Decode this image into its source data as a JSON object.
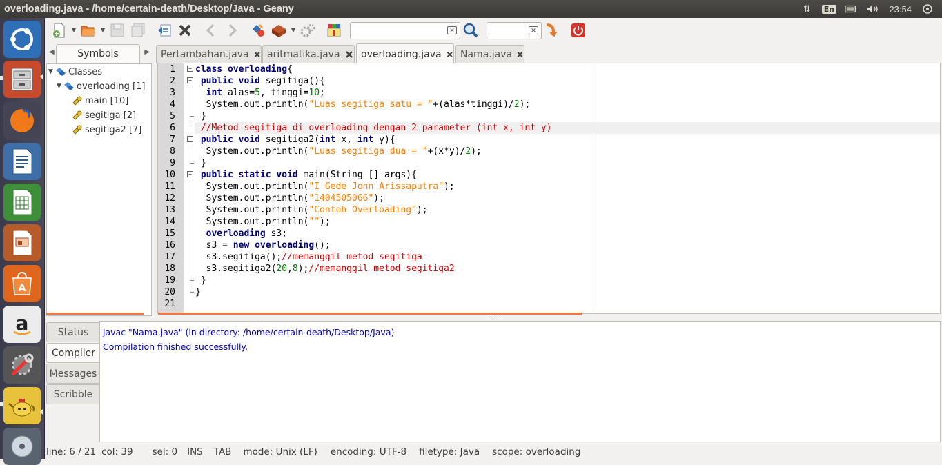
{
  "window": {
    "title": "overloading.java - /home/certain-death/Desktop/Java - Geany"
  },
  "tray": {
    "language": "En",
    "clock": "23:54"
  },
  "toolbar": {
    "search_value": "",
    "goto_value": ""
  },
  "sidebar": {
    "tab_label": "Symbols",
    "tree": [
      {
        "label": "Classes",
        "level": 0,
        "expanded": true
      },
      {
        "label": "overloading [1]",
        "level": 1,
        "expanded": true
      },
      {
        "label": "main [10]",
        "level": 2
      },
      {
        "label": "segitiga [2]",
        "level": 2
      },
      {
        "label": "segitiga2 [7]",
        "level": 2
      }
    ]
  },
  "tabs": [
    {
      "label": "Pertambahan.java",
      "active": false
    },
    {
      "label": "aritmatika.java",
      "active": false
    },
    {
      "label": "overloading.java",
      "active": true
    },
    {
      "label": "Nama.java",
      "active": false
    }
  ],
  "editor": {
    "current_line": 6,
    "lines": [
      {
        "n": "1",
        "fold": "open",
        "tokens": [
          [
            "kw",
            "class"
          ],
          [
            "",
            "​ "
          ],
          [
            "kw",
            "overloading"
          ],
          [
            "",
            "{"
          ]
        ]
      },
      {
        "n": "2",
        "fold": "open",
        "tokens": [
          [
            "",
            "​ "
          ],
          [
            "kw",
            "public"
          ],
          [
            "",
            "​ "
          ],
          [
            "kw",
            "void"
          ],
          [
            "",
            "​ segitiga(){"
          ]
        ]
      },
      {
        "n": "3",
        "fold": "line",
        "tokens": [
          [
            "",
            "​  "
          ],
          [
            "kw",
            "int"
          ],
          [
            "",
            "​ alas="
          ],
          [
            "num",
            "5"
          ],
          [
            "",
            ", tinggi="
          ],
          [
            "num",
            "10"
          ],
          [
            "",
            ";"
          ]
        ]
      },
      {
        "n": "4",
        "fold": "line",
        "tokens": [
          [
            "",
            "​  System.out.println("
          ],
          [
            "str",
            "\"Luas segitiga satu = \""
          ],
          [
            "",
            "+(alas*tinggi)/"
          ],
          [
            "num",
            "2"
          ],
          [
            "",
            ");"
          ]
        ]
      },
      {
        "n": "5",
        "fold": "end",
        "tokens": [
          [
            "",
            "​ }"
          ]
        ]
      },
      {
        "n": "6",
        "fold": "line",
        "tokens": [
          [
            "",
            "​ "
          ],
          [
            "cmt",
            "//Metod segitiga di overloading dengan 2 parameter (int x, int y)"
          ]
        ]
      },
      {
        "n": "7",
        "fold": "open",
        "tokens": [
          [
            "",
            "​ "
          ],
          [
            "kw",
            "public"
          ],
          [
            "",
            "​ "
          ],
          [
            "kw",
            "void"
          ],
          [
            "",
            "​ segitiga2("
          ],
          [
            "kw",
            "int"
          ],
          [
            "",
            "​ x, "
          ],
          [
            "kw",
            "int"
          ],
          [
            "",
            "​ y){"
          ]
        ]
      },
      {
        "n": "8",
        "fold": "line",
        "tokens": [
          [
            "",
            "​  System.out.println("
          ],
          [
            "str",
            "\"Luas segitiga dua = \""
          ],
          [
            "",
            "+(x*y)/"
          ],
          [
            "num",
            "2"
          ],
          [
            "",
            ");"
          ]
        ]
      },
      {
        "n": "9",
        "fold": "end",
        "tokens": [
          [
            "",
            "​ }"
          ]
        ]
      },
      {
        "n": "10",
        "fold": "open",
        "tokens": [
          [
            "",
            "​ "
          ],
          [
            "kw",
            "public"
          ],
          [
            "",
            "​ "
          ],
          [
            "kw",
            "static"
          ],
          [
            "",
            "​ "
          ],
          [
            "kw",
            "void"
          ],
          [
            "",
            "​ main(String [] args){"
          ]
        ]
      },
      {
        "n": "11",
        "fold": "line",
        "tokens": [
          [
            "",
            "​  System.out.println("
          ],
          [
            "str",
            "\"I Gede John Arissaputra\""
          ],
          [
            "",
            ");"
          ]
        ]
      },
      {
        "n": "12",
        "fold": "line",
        "tokens": [
          [
            "",
            "​  System.out.println("
          ],
          [
            "str",
            "\"1404505066\""
          ],
          [
            "",
            ");"
          ]
        ]
      },
      {
        "n": "13",
        "fold": "line",
        "tokens": [
          [
            "",
            "​  System.out.println("
          ],
          [
            "str",
            "\"Contoh Overloading\""
          ],
          [
            "",
            ");"
          ]
        ]
      },
      {
        "n": "14",
        "fold": "line",
        "tokens": [
          [
            "",
            "​  System.out.println("
          ],
          [
            "str",
            "\"\""
          ],
          [
            "",
            ");"
          ]
        ]
      },
      {
        "n": "15",
        "fold": "line",
        "tokens": [
          [
            "",
            "​  "
          ],
          [
            "kw",
            "overloading"
          ],
          [
            "",
            "​ s3;"
          ]
        ]
      },
      {
        "n": "16",
        "fold": "line",
        "tokens": [
          [
            "",
            "​  s3 = "
          ],
          [
            "kw",
            "new"
          ],
          [
            "",
            "​ "
          ],
          [
            "kw",
            "overloading"
          ],
          [
            "",
            "();"
          ]
        ]
      },
      {
        "n": "17",
        "fold": "line",
        "tokens": [
          [
            "",
            "​  s3.segitiga();"
          ],
          [
            "cmt",
            "//memanggil metod segitiga"
          ]
        ]
      },
      {
        "n": "18",
        "fold": "line",
        "tokens": [
          [
            "",
            "​  s3.segitiga2("
          ],
          [
            "num",
            "20"
          ],
          [
            "",
            ","
          ],
          [
            "num",
            "8"
          ],
          [
            "",
            ");"
          ],
          [
            "cmt",
            "//memanggil metod segitiga2"
          ]
        ]
      },
      {
        "n": "19",
        "fold": "end",
        "tokens": [
          [
            "",
            "​ }"
          ]
        ]
      },
      {
        "n": "20",
        "fold": "end",
        "tokens": [
          [
            "",
            "}"
          ]
        ]
      },
      {
        "n": "21",
        "fold": "none",
        "tokens": []
      }
    ]
  },
  "messages": {
    "tabs": [
      "Status",
      "Compiler",
      "Messages",
      "Scribble"
    ],
    "active_tab": "Compiler",
    "lines": [
      "javac \"Nama.java\" (in directory: /home/certain-death/Desktop/Java)",
      "Compilation finished successfully."
    ]
  },
  "statusbar": {
    "items": [
      "line: 6 / 21",
      "col: 39",
      "sel: 0",
      "INS",
      "TAB",
      "mode: Unix (LF)",
      "encoding: UTF-8",
      "filetype: Java",
      "scope: overloading"
    ]
  },
  "colors": {
    "keyword": "#00007f",
    "string": "#ff8000",
    "number": "#007f00",
    "comment": "#d00000",
    "compiler_text": "#0000c0",
    "accent": "#f07746"
  }
}
